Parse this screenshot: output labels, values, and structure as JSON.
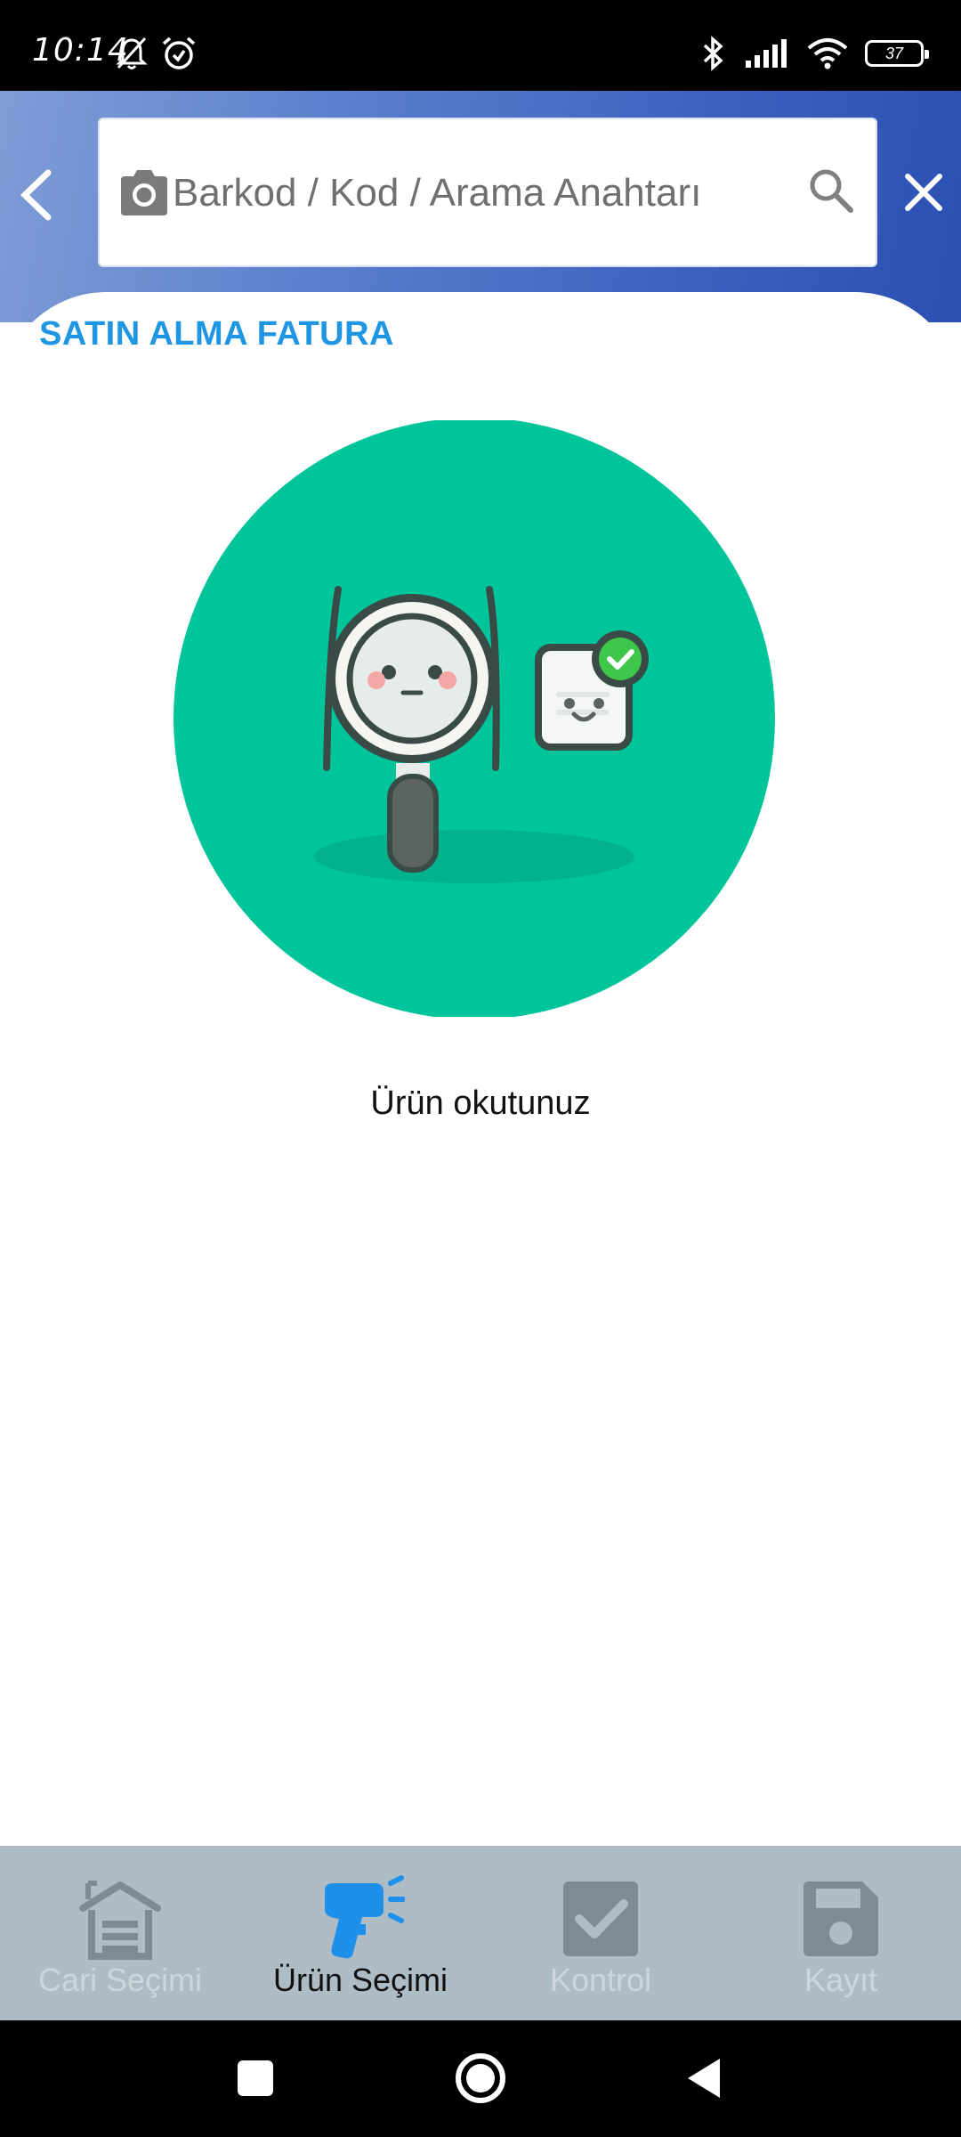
{
  "status_bar": {
    "time": "10:14",
    "battery": "37"
  },
  "header": {
    "search_placeholder": "Barkod / Kod / Arama Anahtarı"
  },
  "panel": {
    "title": "SATIN ALMA FATURA",
    "empty_message": "Ürün okutunuz"
  },
  "bottom_nav": {
    "items": [
      {
        "label": "Cari Seçimi",
        "icon": "warehouse-icon",
        "active": false
      },
      {
        "label": "Ürün Seçimi",
        "icon": "barcode-scanner-icon",
        "active": true
      },
      {
        "label": "Kontrol",
        "icon": "checkbox-icon",
        "active": false
      },
      {
        "label": "Kayıt",
        "icon": "save-icon",
        "active": false
      }
    ]
  },
  "colors": {
    "accent": "#1e96e4",
    "illustration_green": "#00c49a",
    "nav_background": "#aebcc6",
    "nav_inactive": "#cdd6dd"
  }
}
